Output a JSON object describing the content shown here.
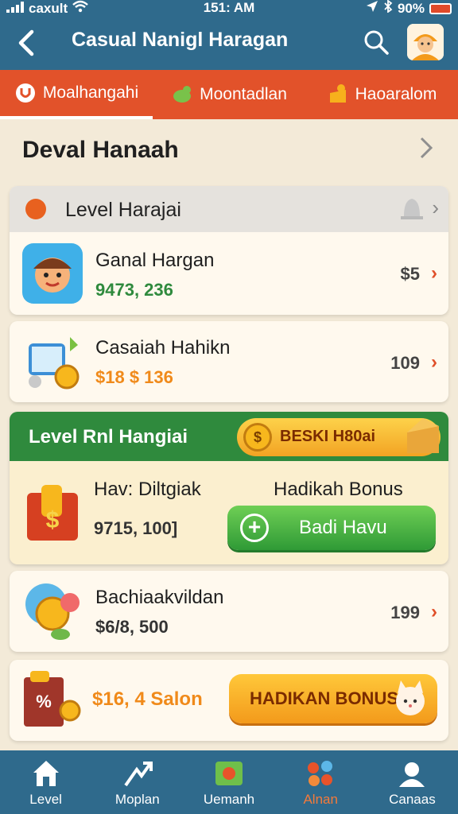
{
  "status": {
    "carrier": "caxult",
    "time": "151: AM",
    "battery": "90%"
  },
  "header": {
    "title": "Casual Nanigl Haragan"
  },
  "tabs": [
    {
      "label": "Moalhangahi"
    },
    {
      "label": "Moontadlan"
    },
    {
      "label": "Haoaralom"
    }
  ],
  "section": {
    "title": "Deval Hanaah"
  },
  "level_card": {
    "header": "Level Harajai"
  },
  "rows": [
    {
      "title": "Ganal Hargan",
      "value": "9473, 236",
      "price": "$5",
      "value_color": "#2f8a3d"
    },
    {
      "title": "Casaiah Hahikn",
      "value": "$18 $ 136",
      "price": "109",
      "value_color": "#f08a1a"
    }
  ],
  "promo": {
    "header": "Level Rnl Hangiai",
    "pill_text": "BESKI H80ai",
    "title": "Hav: Diltgiak",
    "value": "9715, 100]",
    "right_title": "Hadikah Bonus",
    "button": "Badi Havu"
  },
  "row3": {
    "title": "Bachiaakvildan",
    "value": "$6/8, 500",
    "price": "199"
  },
  "bottom_card": {
    "text": "$16, 4 Salon",
    "button": "HADIKAN BONUS"
  },
  "nav": [
    {
      "label": "Level"
    },
    {
      "label": "Moplan"
    },
    {
      "label": "Uemanh"
    },
    {
      "label": "Alnan"
    },
    {
      "label": "Canaas"
    }
  ]
}
